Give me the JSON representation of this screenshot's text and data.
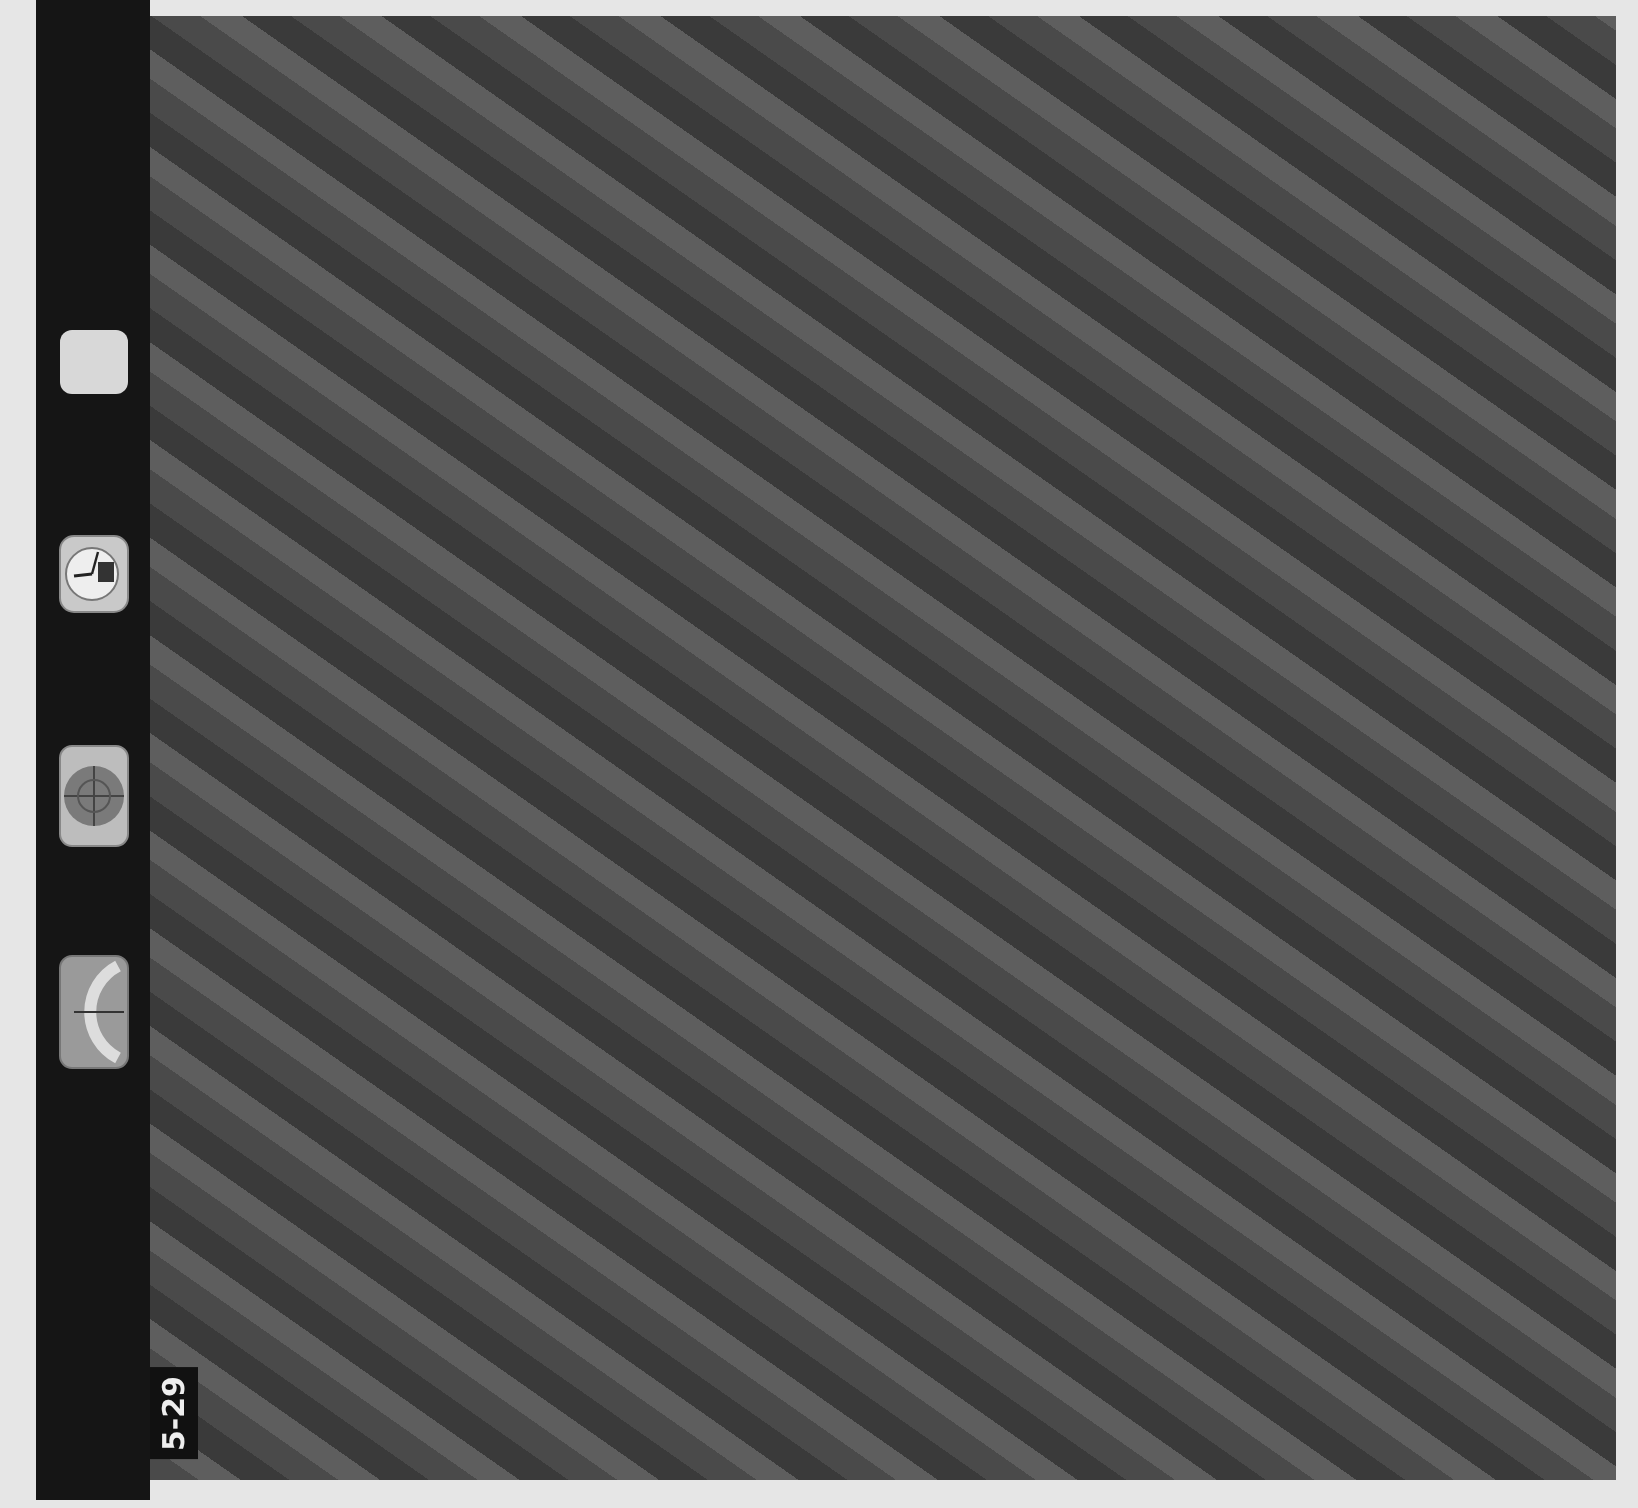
{
  "frame_number": "5-29"
}
